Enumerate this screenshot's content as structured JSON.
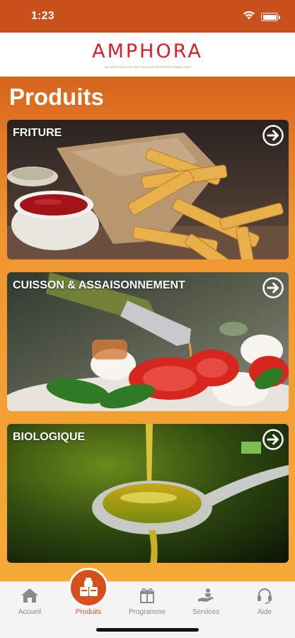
{
  "status_bar": {
    "time": "1:23"
  },
  "brand": {
    "name": "AMPHORA",
    "tagline": "· LE SPÉCIALISTE DES HUILES PROFESSIONNELLES ·"
  },
  "page": {
    "title": "Produits"
  },
  "categories": [
    {
      "label": "FRITURE",
      "image_icon": "fries-photo"
    },
    {
      "label": "CUISSON & ASSAISONNEMENT",
      "image_icon": "caprese-oil-photo"
    },
    {
      "label": "BIOLOGIQUE",
      "image_icon": "olive-oil-spoon-photo"
    }
  ],
  "nav": {
    "items": [
      {
        "label": "Accueil",
        "icon": "home-icon"
      },
      {
        "label": "Produits",
        "icon": "products-icon"
      },
      {
        "label": "Programme",
        "icon": "gift-icon"
      },
      {
        "label": "Services",
        "icon": "service-hand-icon"
      },
      {
        "label": "Aide",
        "icon": "headset-icon"
      }
    ],
    "active": "Produits"
  },
  "colors": {
    "status_bar": "#c9501c",
    "brand_red": "#d81f26",
    "accent_orange": "#f6a936",
    "nav_active": "#d05a22"
  }
}
